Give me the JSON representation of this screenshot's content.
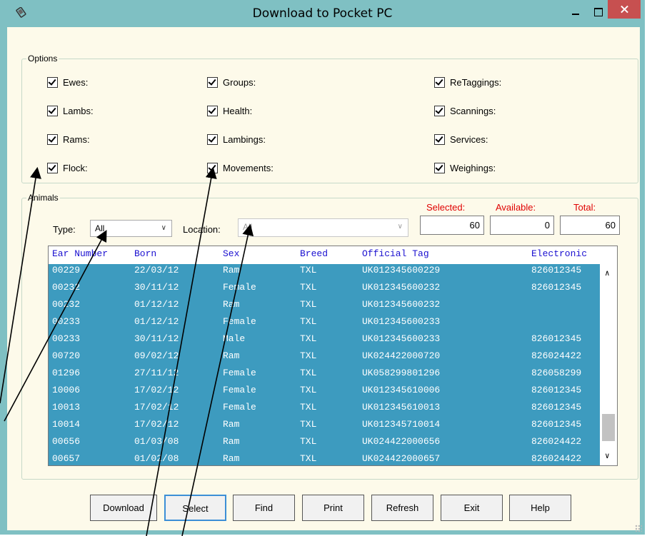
{
  "window": {
    "title": "Download to Pocket PC"
  },
  "options": {
    "legend": "Options",
    "checkboxes": [
      {
        "label": "Ewes:",
        "checked": true
      },
      {
        "label": "Lambs:",
        "checked": true
      },
      {
        "label": "Rams:",
        "checked": true
      },
      {
        "label": "Flock:",
        "checked": true
      },
      {
        "label": "Groups:",
        "checked": true
      },
      {
        "label": "Health:",
        "checked": true
      },
      {
        "label": "Lambings:",
        "checked": true
      },
      {
        "label": "Movements:",
        "checked": true
      },
      {
        "label": "ReTaggings:",
        "checked": true
      },
      {
        "label": "Scannings:",
        "checked": true
      },
      {
        "label": "Services:",
        "checked": true
      },
      {
        "label": "Weighings:",
        "checked": true
      }
    ]
  },
  "animals": {
    "legend": "Animals",
    "type_label": "Type:",
    "type_value": "All",
    "location_label": "Location:",
    "location_value": "All",
    "counts": {
      "selected_label": "Selected:",
      "selected": "60",
      "available_label": "Available:",
      "available": "0",
      "total_label": "Total:",
      "total": "60"
    },
    "columns": [
      "Ear Number",
      "Born",
      "Sex",
      "Breed",
      "Official Tag",
      "Electronic"
    ],
    "rows": [
      [
        "00229",
        "22/03/12",
        "Ram",
        "TXL",
        "UK012345600229",
        "826012345"
      ],
      [
        "00232",
        "30/11/12",
        "Female",
        "TXL",
        "UK012345600232",
        "826012345"
      ],
      [
        "00232",
        "01/12/12",
        "Ram",
        "TXL",
        "UK012345600232",
        ""
      ],
      [
        "00233",
        "01/12/12",
        "Female",
        "TXL",
        "UK012345600233",
        ""
      ],
      [
        "00233",
        "30/11/12",
        "Male",
        "TXL",
        "UK012345600233",
        "826012345"
      ],
      [
        "00720",
        "09/02/12",
        "Ram",
        "TXL",
        "UK024422000720",
        "826024422"
      ],
      [
        "01296",
        "27/11/12",
        "Female",
        "TXL",
        "UK058299801296",
        "826058299"
      ],
      [
        "10006",
        "17/02/12",
        "Female",
        "TXL",
        "UK012345610006",
        "826012345"
      ],
      [
        "10013",
        "17/02/12",
        "Female",
        "TXL",
        "UK012345610013",
        "826012345"
      ],
      [
        "10014",
        "17/02/12",
        "Ram",
        "TXL",
        "UK012345710014",
        "826012345"
      ],
      [
        "00656",
        "01/03/08",
        "Ram",
        "TXL",
        "UK024422000656",
        "826024422"
      ],
      [
        "00657",
        "01/02/08",
        "Ram",
        "TXL",
        "UK024422000657",
        "826024422"
      ]
    ]
  },
  "buttons": [
    "Download",
    "Select",
    "Find",
    "Print",
    "Refresh",
    "Exit",
    "Help"
  ],
  "colors": {
    "titlebar": "#7fc0c3",
    "client": "#fdfaea",
    "selection": "#3d9bbf",
    "header_text": "#1a0fd0",
    "close": "#c75050",
    "count_labels": "#e00000"
  }
}
